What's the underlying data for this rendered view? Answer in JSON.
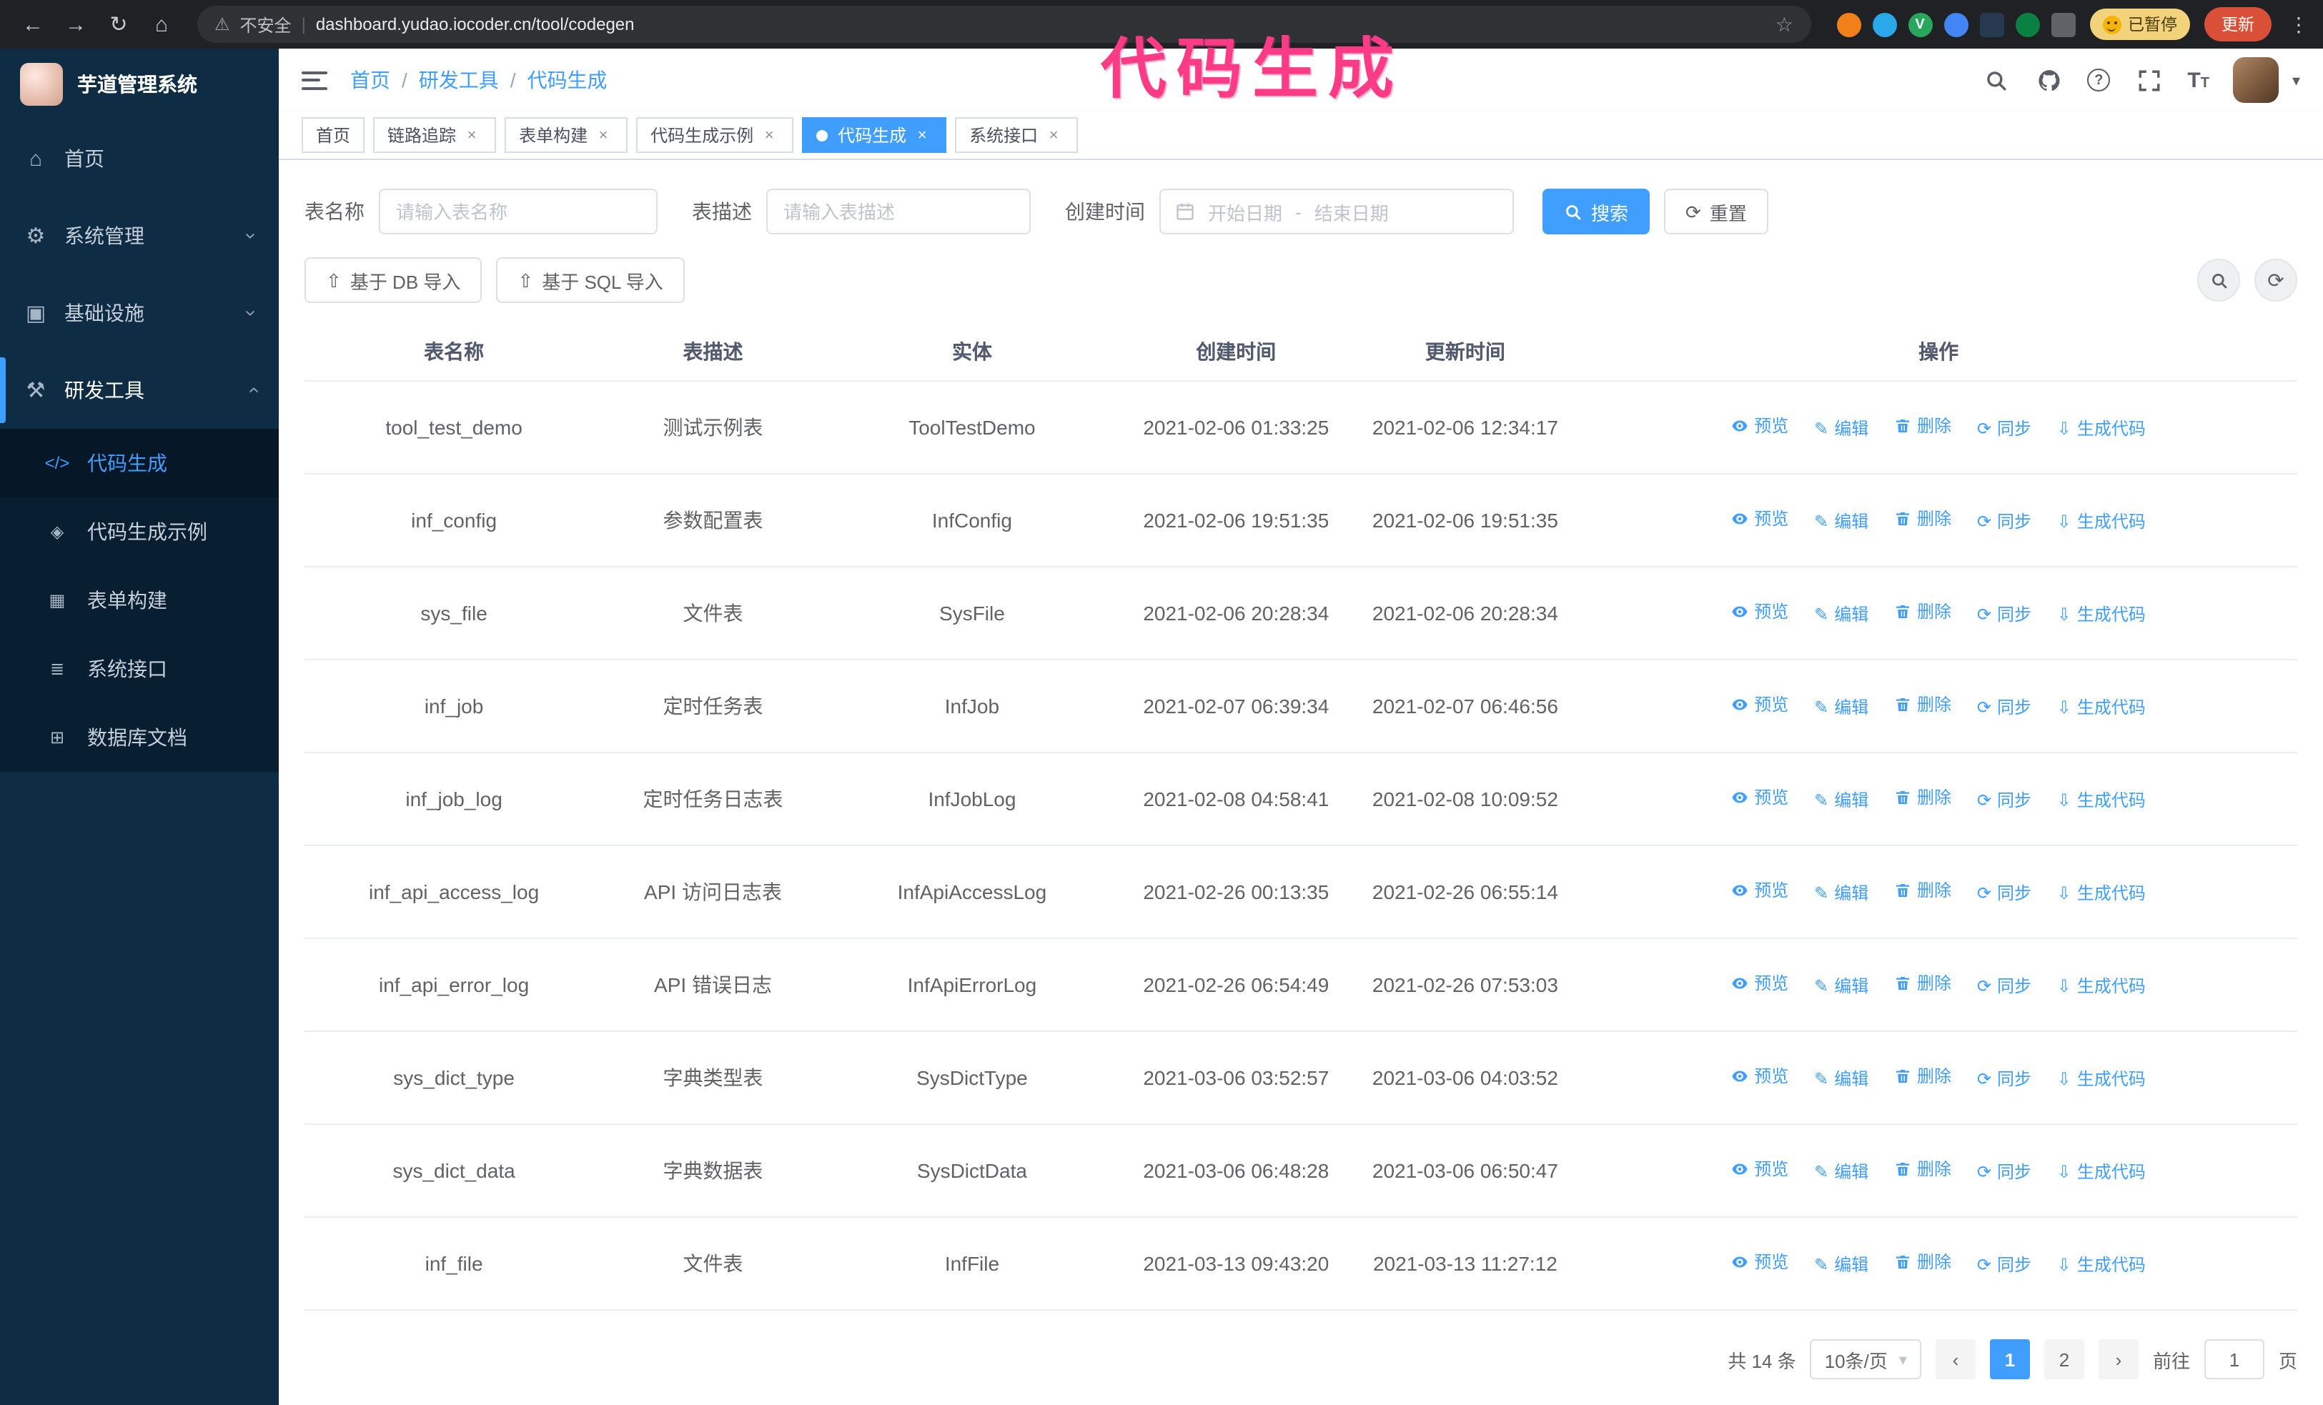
{
  "colors": {
    "accent": "#409eff",
    "annotation_pink": "#fb3b85",
    "sidebar_bg": "#0e2c44",
    "submenu_bg": "#081e31",
    "active_tag_bg": "#409eff"
  },
  "browser": {
    "security_label": "不安全",
    "url": "dashboard.yudao.iocoder.cn/tool/codegen",
    "extension_letter": "V",
    "paused_badge": "已暂停",
    "update_button": "更新"
  },
  "annotation": {
    "text": "代码生成"
  },
  "sidebar": {
    "logo_title": "芋道管理系统",
    "menu": {
      "home": "首页",
      "system": "系统管理",
      "infra": "基础设施",
      "devtools": "研发工具"
    },
    "submenu": {
      "codegen": "代码生成",
      "codegen_example": "代码生成示例",
      "form_builder": "表单构建",
      "system_api": "系统接口",
      "db_doc": "数据库文档"
    }
  },
  "breadcrumb": {
    "items": [
      "首页",
      "研发工具",
      "代码生成"
    ],
    "separator": "/"
  },
  "tabs": [
    "首页",
    "链路追踪",
    "表单构建",
    "代码生成示例",
    "代码生成",
    "系统接口"
  ],
  "filters": {
    "name_label": "表名称",
    "name_placeholder": "请输入表名称",
    "desc_label": "表描述",
    "desc_placeholder": "请输入表描述",
    "time_label": "创建时间",
    "date_start": "开始日期",
    "date_separator": "-",
    "date_end": "结束日期",
    "search": "搜索",
    "reset": "重置"
  },
  "toolbar": {
    "import_db": "基于 DB 导入",
    "import_sql": "基于 SQL 导入"
  },
  "table": {
    "columns": [
      "表名称",
      "表描述",
      "实体",
      "创建时间",
      "更新时间",
      "操作"
    ],
    "ops": {
      "preview": "预览",
      "edit": "编辑",
      "delete": "删除",
      "sync": "同步",
      "generate": "生成代码"
    },
    "rows": [
      {
        "name": "tool_test_demo",
        "desc": "测试示例表",
        "entity": "ToolTestDemo",
        "created": "2021-02-06 01:33:25",
        "updated": "2021-02-06 12:34:17"
      },
      {
        "name": "inf_config",
        "desc": "参数配置表",
        "entity": "InfConfig",
        "created": "2021-02-06 19:51:35",
        "updated": "2021-02-06 19:51:35"
      },
      {
        "name": "sys_file",
        "desc": "文件表",
        "entity": "SysFile",
        "created": "2021-02-06 20:28:34",
        "updated": "2021-02-06 20:28:34"
      },
      {
        "name": "inf_job",
        "desc": "定时任务表",
        "entity": "InfJob",
        "created": "2021-02-07 06:39:34",
        "updated": "2021-02-07 06:46:56"
      },
      {
        "name": "inf_job_log",
        "desc": "定时任务日志表",
        "entity": "InfJobLog",
        "created": "2021-02-08 04:58:41",
        "updated": "2021-02-08 10:09:52"
      },
      {
        "name": "inf_api_access_log",
        "desc": "API 访问日志表",
        "entity": "InfApiAccessLog",
        "created": "2021-02-26 00:13:35",
        "updated": "2021-02-26 06:55:14"
      },
      {
        "name": "inf_api_error_log",
        "desc": "API 错误日志",
        "entity": "InfApiErrorLog",
        "created": "2021-02-26 06:54:49",
        "updated": "2021-02-26 07:53:03"
      },
      {
        "name": "sys_dict_type",
        "desc": "字典类型表",
        "entity": "SysDictType",
        "created": "2021-03-06 03:52:57",
        "updated": "2021-03-06 04:03:52"
      },
      {
        "name": "sys_dict_data",
        "desc": "字典数据表",
        "entity": "SysDictData",
        "created": "2021-03-06 06:48:28",
        "updated": "2021-03-06 06:50:47"
      },
      {
        "name": "inf_file",
        "desc": "文件表",
        "entity": "InfFile",
        "created": "2021-03-13 09:43:20",
        "updated": "2021-03-13 11:27:12"
      }
    ]
  },
  "pagination": {
    "total": "共 14 条",
    "page_size": "10条/页",
    "pages": [
      "1",
      "2"
    ],
    "goto_label": "前往",
    "goto_value": "1",
    "goto_suffix": "页"
  }
}
